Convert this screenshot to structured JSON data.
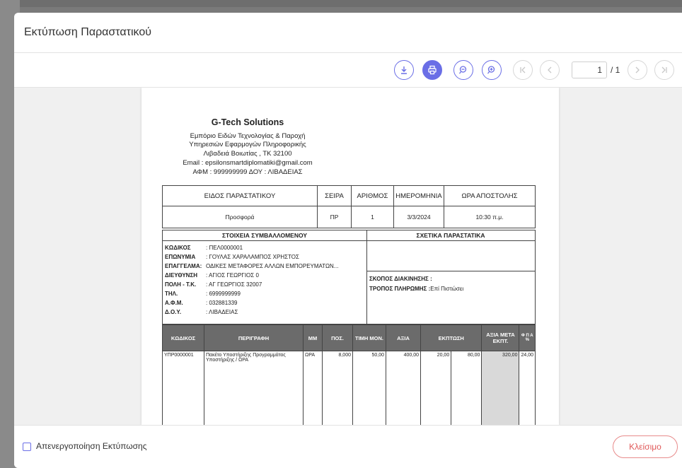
{
  "modal": {
    "title": "Εκτύπωση Παραστατικού"
  },
  "toolbar": {
    "buttons": [
      "download-icon",
      "print-icon",
      "zoom-out-icon",
      "zoom-in-icon",
      "first-page-icon",
      "prev-page-icon",
      "next-page-icon",
      "last-page-icon"
    ],
    "page_value": "1",
    "page_total": "/ 1"
  },
  "doc": {
    "company_name": "G-Tech Solutions",
    "company_lines": [
      "Εμπόριο Ειδών Τεχνολογίας & Παροχή",
      "Υπηρεσιών Εφαρμογών Πληροφορικής",
      "Λιβαδειά Βοιωτίας , ΤΚ 32100",
      "Email : epsilonsmartdiplomatiki@gmail.com",
      "ΑΦΜ : 999999999 ΔΟΥ : ΛΙΒΑΔΕΙΑΣ"
    ],
    "header_table": {
      "headers": [
        "ΕΙΔΟΣ ΠΑΡΑΣΤΑΤΙΚΟΥ",
        "ΣΕΙΡΑ",
        "ΑΡΙΘΜΟΣ",
        "ΗΜΕΡΟΜΗΝΙΑ",
        "ΩΡΑ ΑΠΟΣΤΟΛΗΣ"
      ],
      "values": [
        "Προσφορά",
        "ΠΡ",
        "1",
        "3/3/2024",
        "10:30 π.μ."
      ]
    },
    "party": {
      "heading": "ΣΤΟΙΧΕΙΑ ΣΥΜΒΑΛΛΟΜΕΝΟΥ",
      "rows": [
        {
          "label": "ΚΩΔΙΚΟΣ",
          "value": ": ΠΕΛ0000001"
        },
        {
          "label": "ΕΠΩΝΥΜΙΑ",
          "value": ": ΓΟΥΛΑΣ ΧΑΡΑΛΑΜΠΟΣ ΧΡΗΣΤΟΣ"
        },
        {
          "label": "ΕΠΑΓΓΕΛΜΑ:",
          "value": "ΟΔΙΚΕΣ ΜΕΤΑΦΟΡΕΣ ΑΛΛΩΝ ΕΜΠΟΡΕΥΜΑΤΩΝ..."
        },
        {
          "label": "ΔΙΕΥΘΥΝΣΗ",
          "value": ": ΑΓΙΟΣ ΓΕΩΡΓΙΟΣ 0"
        },
        {
          "label": "ΠΟΛΗ - Τ.Κ.",
          "value": ": ΑΓ ΓΕΩΡΓΙΟΣ 32007"
        },
        {
          "label": "ΤΗΛ.",
          "value": ": 6999999999"
        },
        {
          "label": "Α.Φ.Μ.",
          "value": ": 032881339"
        },
        {
          "label": "Δ.Ο.Υ.",
          "value": ": ΛΙΒΑΔΕΙΑΣ"
        }
      ]
    },
    "related": {
      "heading": "ΣΧΕΤΙΚΑ ΠΑΡΑΣΤΑΤΙΚΑ",
      "purpose_label": "ΣΚΟΠΟΣ ΔΙΑΚΙΝΗΣΗΣ :",
      "payment_label": "ΤΡΟΠΟΣ ΠΛΗΡΩΜΗΣ :",
      "payment_value": "Επί Πιστώσει"
    },
    "lines": {
      "headers": [
        "ΚΩΔΙΚΟΣ",
        "ΠΕΡΙΓΡΑΦΗ",
        "ΜΜ",
        "ΠΟΣ.",
        "ΤΙΜΗ ΜΟΝ.",
        "ΑΞΙΑ",
        "ΕΚΠΤΩΣΗ",
        "ΑΞΙΑ ΜΕΤΑ ΕΚΠΤ.",
        "Φ Π Α %"
      ],
      "rows": [
        [
          "ΥΠΡ0000001",
          "Πακέτο Υποστήριξης Προγραμμάτος Υποστήριξης / ΩΡΑ",
          "ΩΡΑ",
          "8,000",
          "50,00",
          "400,00",
          "20,00",
          "80,00",
          "320,00",
          "24,00"
        ]
      ]
    }
  },
  "footer": {
    "checkbox_label": "Απενεργοποίηση Εκτύπωσης",
    "close_label": "Κλείσιμο"
  },
  "colors": {
    "accent": "#6a6ee6",
    "danger": "#e05a5a"
  }
}
